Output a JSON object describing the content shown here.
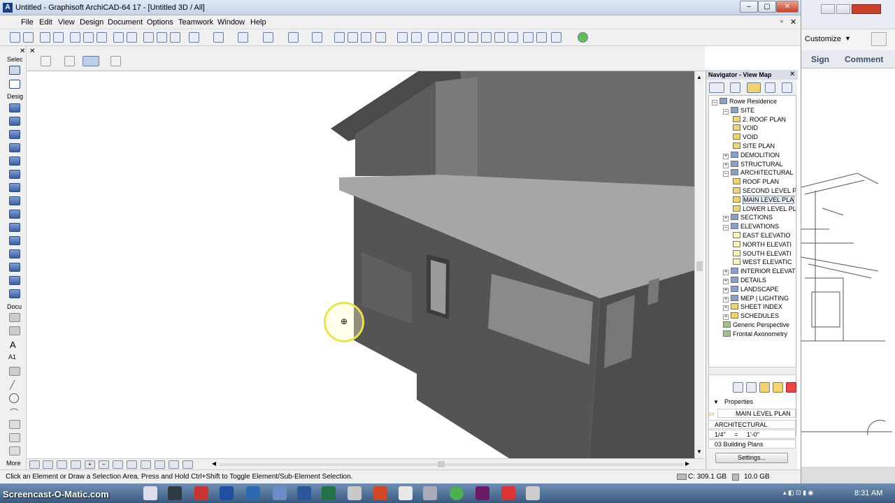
{
  "window": {
    "title": "Untitled - Graphisoft ArchiCAD-64 17 - [Untitled 3D / All]",
    "minimize": "–",
    "maximize": "▢",
    "close": "✕"
  },
  "menu": [
    "File",
    "Edit",
    "View",
    "Design",
    "Document",
    "Options",
    "Teamwork",
    "Window",
    "Help"
  ],
  "toolbox": {
    "select_label": "Selec",
    "design_label": "Desig",
    "document_label": "Docu",
    "more_label": "More"
  },
  "navigator": {
    "title": "Navigator - View Map",
    "items": [
      {
        "label": "Rowe Residence",
        "level": 0,
        "icon": "book"
      },
      {
        "label": "SITE",
        "level": 1,
        "icon": "book",
        "pm": "–"
      },
      {
        "label": "2. ROOF PLAN",
        "level": 2,
        "icon": "fold"
      },
      {
        "label": "VOID",
        "level": 2,
        "icon": "fold"
      },
      {
        "label": "VOID",
        "level": 2,
        "icon": "fold"
      },
      {
        "label": "SITE PLAN",
        "level": 2,
        "icon": "fold"
      },
      {
        "label": "DEMOLITION",
        "level": 1,
        "icon": "book",
        "pm": "+"
      },
      {
        "label": "STRUCTURAL",
        "level": 1,
        "icon": "book",
        "pm": "+"
      },
      {
        "label": "ARCHITECTURAL",
        "level": 1,
        "icon": "book",
        "pm": "–"
      },
      {
        "label": "ROOF PLAN",
        "level": 2,
        "icon": "fold"
      },
      {
        "label": "SECOND LEVEL P",
        "level": 2,
        "icon": "fold"
      },
      {
        "label": "MAIN LEVEL PLA",
        "level": 2,
        "icon": "fold",
        "selected": true
      },
      {
        "label": "LOWER LEVEL PL",
        "level": 2,
        "icon": "fold"
      },
      {
        "label": "SECTIONS",
        "level": 1,
        "icon": "book",
        "pm": "+"
      },
      {
        "label": "ELEVATIONS",
        "level": 1,
        "icon": "book",
        "pm": "–"
      },
      {
        "label": "EAST ELEVATIO",
        "level": 2,
        "icon": "view"
      },
      {
        "label": "NORTH ELEVATI",
        "level": 2,
        "icon": "view"
      },
      {
        "label": "SOUTH ELEVATI",
        "level": 2,
        "icon": "view"
      },
      {
        "label": "WEST ELEVATIC",
        "level": 2,
        "icon": "view"
      },
      {
        "label": "INTERIOR ELEVATIC",
        "level": 1,
        "icon": "book",
        "pm": "+"
      },
      {
        "label": "DETAILS",
        "level": 1,
        "icon": "book",
        "pm": "+"
      },
      {
        "label": "LANDSCAPE",
        "level": 1,
        "icon": "book",
        "pm": "+"
      },
      {
        "label": "MEP | LIGHTING",
        "level": 1,
        "icon": "book",
        "pm": "+"
      },
      {
        "label": "SHEET INDEX",
        "level": 1,
        "icon": "fold",
        "pm": "+"
      },
      {
        "label": "SCHEDULES",
        "level": 1,
        "icon": "fold",
        "pm": "+"
      },
      {
        "label": "Generic Perspective",
        "level": 1,
        "icon": "grn"
      },
      {
        "label": "Frontal Axonometry",
        "level": 1,
        "icon": "grn"
      }
    ],
    "properties": {
      "heading": "Properties",
      "name": "MAIN LEVEL PLAN",
      "layer": "ARCHITECTURAL",
      "scale_left": "1/4\"",
      "scale_eq": "=",
      "scale_right": "1'-0\"",
      "set": "03 Building Plans",
      "settings_button": "Settings..."
    }
  },
  "status": {
    "hint": "Click an Element or Draw a Selection Area. Press and Hold Ctrl+Shift to Toggle Element/Sub-Element Selection.",
    "disk_c": "C: 309.1 GB",
    "ram": "10.0 GB"
  },
  "right_panel": {
    "customize": "Customize",
    "sign": "Sign",
    "comment": "Comment"
  },
  "taskbar": {
    "watermark": "Screencast-O-Matic.com",
    "time": "8:31 AM"
  }
}
